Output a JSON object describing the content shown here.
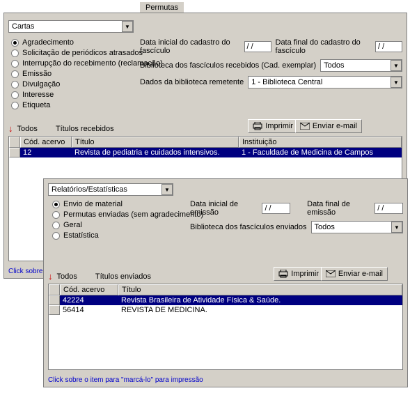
{
  "tabs": {
    "permutas": "Permutas"
  },
  "panel1": {
    "dropdown": "Cartas",
    "radios": [
      "Agradecimento",
      "Solicitação de periódicos atrasados",
      "Interrupção do recebimento (reclamação)",
      "Emissão",
      "Divulgação",
      "Interesse",
      "Etiqueta"
    ],
    "fields": {
      "dataInicialLabel": "Data inicial do cadastro do fascículo",
      "dataInicialValue": "/ /",
      "dataFinalLabel": "Data final do cadastro do fascículo",
      "dataFinalValue": "/ /",
      "bibRecLabel": "Biblioteca dos fascículos recebidos (Cad. exemplar)",
      "bibRecValue": "Todos",
      "dadosBibLabel": "Dados da biblioteca remetente",
      "dadosBibValue": "1 - Biblioteca Central"
    },
    "todos": "Todos",
    "sectionLabel": "Títulos recebidos",
    "btnImprimir": "Imprimir",
    "btnEnviar": "Enviar e-mail",
    "tableHeaders": {
      "cod": "Cód. acervo",
      "titulo": "Título",
      "inst": "Instituição"
    },
    "tableRow": {
      "cod": "12",
      "titulo": "Revista de pediatria e cuidados intensivos.",
      "inst": "1 - Faculdade de Medicina de Campos"
    },
    "linkText": "Click sobre o"
  },
  "panel2": {
    "dropdown": "Relatórios/Estatísticas",
    "radios": [
      "Envio de material",
      "Permutas enviadas (sem agradecimento)",
      "Geral",
      "Estatística"
    ],
    "fields": {
      "dataInicialLabel": "Data inicial de emissão",
      "dataInicialValue": "/ /",
      "dataFinalLabel": "Data final de emissão",
      "dataFinalValue": "/ /",
      "bibEnvLabel": "Biblioteca dos fascículos enviados",
      "bibEnvValue": "Todos"
    },
    "todos": "Todos",
    "sectionLabel": "Títulos enviados",
    "btnImprimir": "Imprimir",
    "btnEnviar": "Enviar e-mail",
    "tableHeaders": {
      "cod": "Cód. acervo",
      "titulo": "Título"
    },
    "rows": [
      {
        "cod": "42224",
        "titulo": "Revista Brasileira de Atividade Física & Saúde."
      },
      {
        "cod": "56414",
        "titulo": "REVISTA DE MEDICINA."
      }
    ],
    "linkText": "Click sobre o item para \"marcá-lo\" para impressão"
  }
}
